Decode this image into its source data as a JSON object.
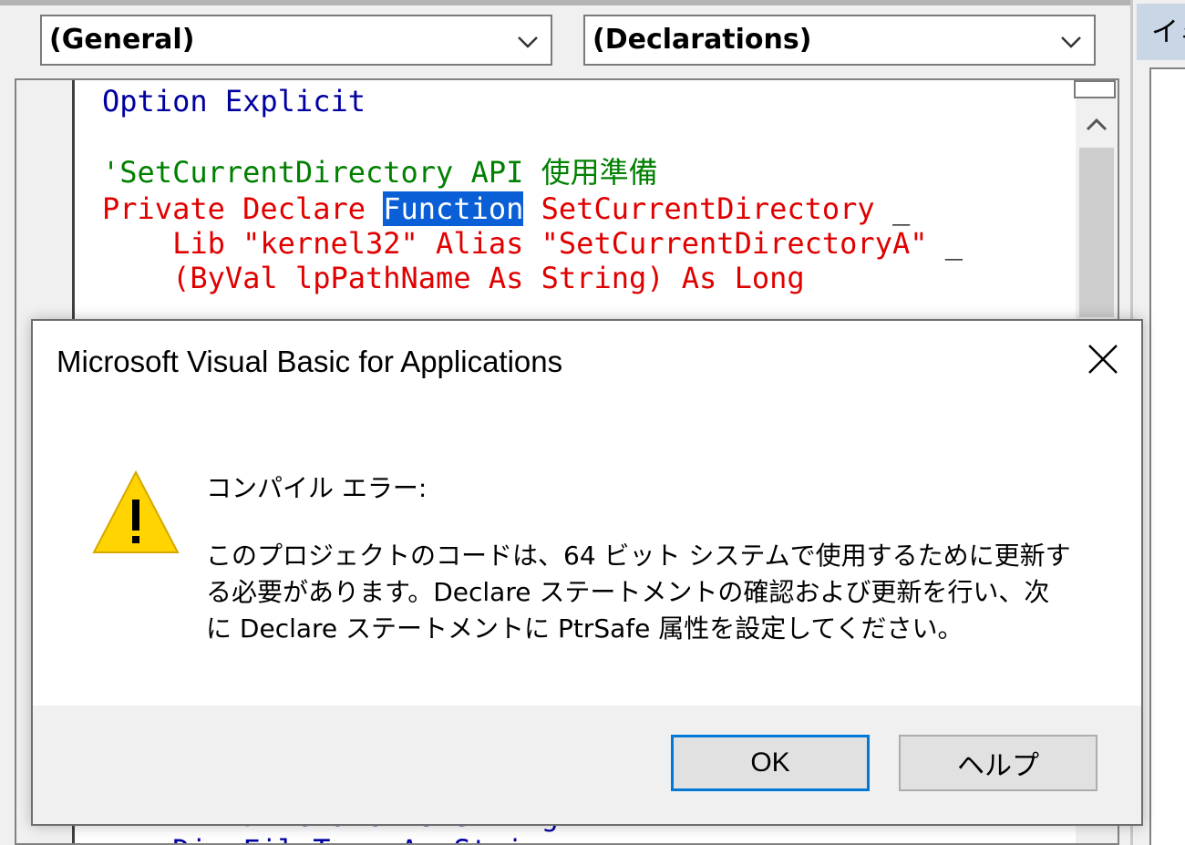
{
  "editor": {
    "object_combo": "(General)",
    "procedure_combo": "(Declarations)",
    "right_panel_title": "イミ",
    "code": {
      "line1": "Option Explicit",
      "comment": "'SetCurrentDirectory API 使用準備",
      "decl_private": "Private Declare ",
      "decl_function": "Function",
      "decl_name": " SetCurrentDirectory ",
      "cont_char": "_",
      "lib_line": "    Lib \"kernel32\" Alias \"SetCurrentDirectoryA\" ",
      "byval_line": "    (ByVal lpPathName As String) As Long",
      "hidden1": "    Dim FileName As String",
      "hidden2": "    Dim FileType As String"
    }
  },
  "dialog": {
    "title": "Microsoft Visual Basic for Applications",
    "heading": "コンパイル エラー:",
    "message": "このプロジェクトのコードは、64 ビット システムで使用するために更新する必要があります。Declare ステートメントの確認および更新を行い、次に Declare ステートメントに PtrSafe 属性を設定してください。",
    "ok_label": "OK",
    "help_label": "ヘルプ",
    "icon": "warning-icon"
  },
  "colors": {
    "keyword": "#0000a0",
    "comment": "#008000",
    "error": "#e00000",
    "selection": "#0a5fd6",
    "button_focus": "#0078d7"
  }
}
